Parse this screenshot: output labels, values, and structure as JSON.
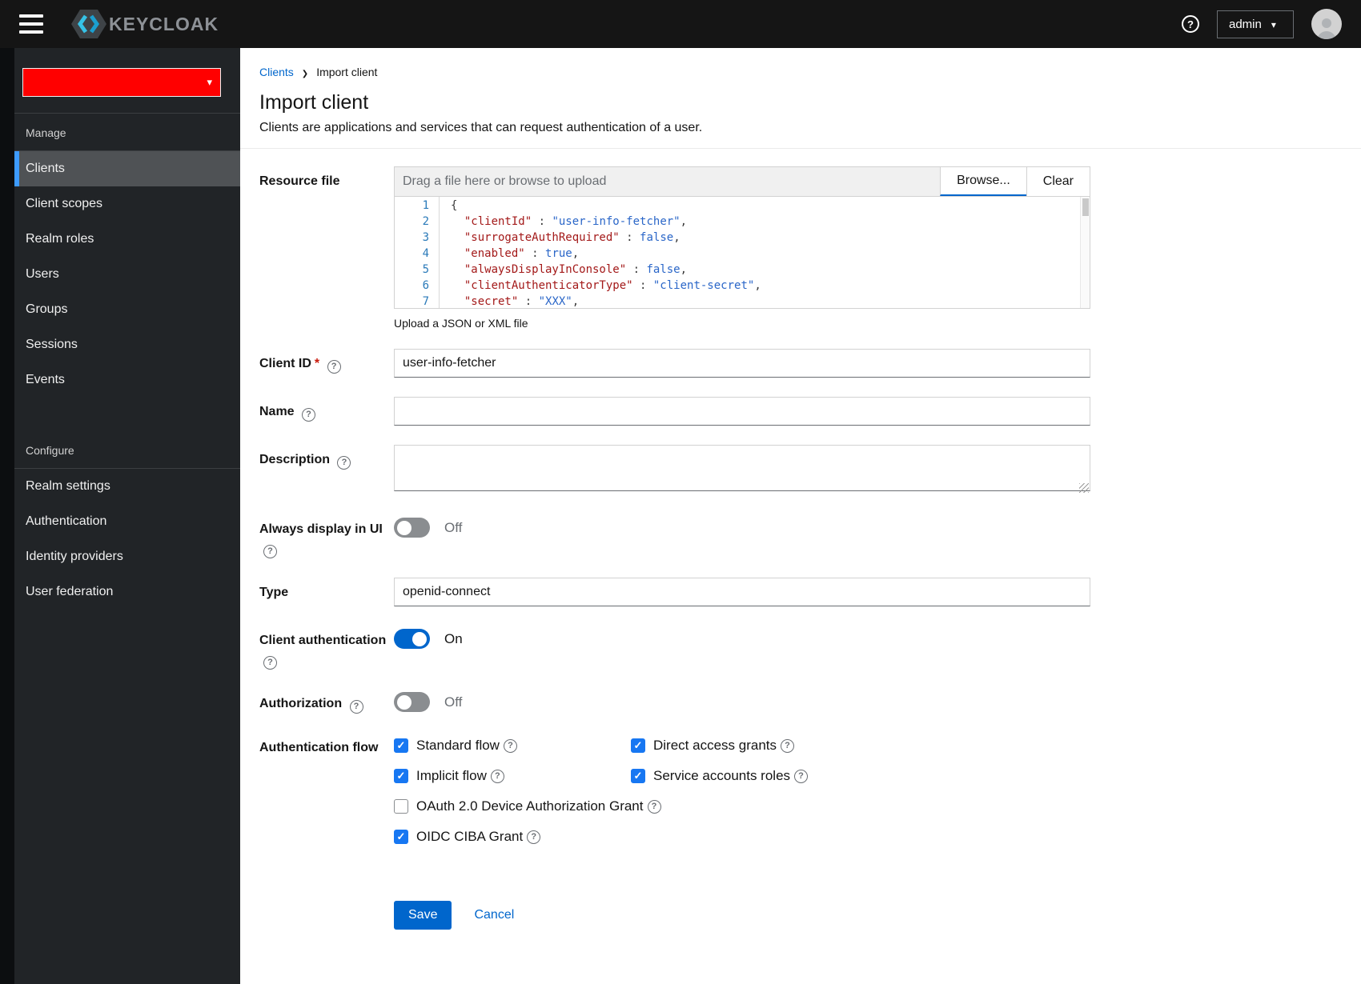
{
  "topbar": {
    "brand": "KEYCLOAK",
    "user": "admin"
  },
  "sidebar": {
    "sections": [
      {
        "label": "Manage",
        "items": [
          {
            "label": "Clients",
            "active": true
          },
          {
            "label": "Client scopes"
          },
          {
            "label": "Realm roles"
          },
          {
            "label": "Users"
          },
          {
            "label": "Groups"
          },
          {
            "label": "Sessions"
          },
          {
            "label": "Events"
          }
        ]
      },
      {
        "label": "Configure",
        "items": [
          {
            "label": "Realm settings"
          },
          {
            "label": "Authentication"
          },
          {
            "label": "Identity providers"
          },
          {
            "label": "User federation"
          }
        ]
      }
    ]
  },
  "breadcrumb": {
    "parent": "Clients",
    "current": "Import client"
  },
  "page": {
    "title": "Import client",
    "subtitle": "Clients are applications and services that can request authentication of a user."
  },
  "form": {
    "resource_file": {
      "label": "Resource file",
      "placeholder": "Drag a file here or browse to upload",
      "browse": "Browse...",
      "clear": "Clear",
      "helper": "Upload a JSON or XML file"
    },
    "code_editor": {
      "lines": [
        {
          "num": "1",
          "tokens": [
            {
              "t": "punc",
              "s": "{"
            }
          ]
        },
        {
          "num": "2",
          "tokens": [
            {
              "t": "ws",
              "s": "  "
            },
            {
              "t": "key",
              "s": "\"clientId\""
            },
            {
              "t": "punc",
              "s": " : "
            },
            {
              "t": "str",
              "s": "\"user-info-fetcher\""
            },
            {
              "t": "punc",
              "s": ","
            }
          ]
        },
        {
          "num": "3",
          "tokens": [
            {
              "t": "ws",
              "s": "  "
            },
            {
              "t": "key",
              "s": "\"surrogateAuthRequired\""
            },
            {
              "t": "punc",
              "s": " : "
            },
            {
              "t": "bool",
              "s": "false"
            },
            {
              "t": "punc",
              "s": ","
            }
          ]
        },
        {
          "num": "4",
          "tokens": [
            {
              "t": "ws",
              "s": "  "
            },
            {
              "t": "key",
              "s": "\"enabled\""
            },
            {
              "t": "punc",
              "s": " : "
            },
            {
              "t": "bool",
              "s": "true"
            },
            {
              "t": "punc",
              "s": ","
            }
          ]
        },
        {
          "num": "5",
          "tokens": [
            {
              "t": "ws",
              "s": "  "
            },
            {
              "t": "key",
              "s": "\"alwaysDisplayInConsole\""
            },
            {
              "t": "punc",
              "s": " : "
            },
            {
              "t": "bool",
              "s": "false"
            },
            {
              "t": "punc",
              "s": ","
            }
          ]
        },
        {
          "num": "6",
          "tokens": [
            {
              "t": "ws",
              "s": "  "
            },
            {
              "t": "key",
              "s": "\"clientAuthenticatorType\""
            },
            {
              "t": "punc",
              "s": " : "
            },
            {
              "t": "str",
              "s": "\"client-secret\""
            },
            {
              "t": "punc",
              "s": ","
            }
          ]
        },
        {
          "num": "7",
          "tokens": [
            {
              "t": "ws",
              "s": "  "
            },
            {
              "t": "key",
              "s": "\"secret\""
            },
            {
              "t": "punc",
              "s": " : "
            },
            {
              "t": "str",
              "s": "\"XXX\""
            },
            {
              "t": "punc",
              "s": ","
            }
          ]
        }
      ]
    },
    "client_id": {
      "label": "Client ID",
      "required": "*",
      "value": "user-info-fetcher"
    },
    "name": {
      "label": "Name",
      "value": ""
    },
    "description": {
      "label": "Description",
      "value": ""
    },
    "always_display": {
      "label": "Always display in UI",
      "state": "Off"
    },
    "type": {
      "label": "Type",
      "value": "openid-connect"
    },
    "client_auth": {
      "label": "Client authentication",
      "state": "On"
    },
    "authorization": {
      "label": "Authorization",
      "state": "Off"
    },
    "auth_flow": {
      "label": "Authentication flow",
      "options": [
        {
          "label": "Standard flow",
          "checked": true
        },
        {
          "label": "Direct access grants",
          "checked": true
        },
        {
          "label": "Implicit flow",
          "checked": true
        },
        {
          "label": "Service accounts roles",
          "checked": true
        },
        {
          "label": "OAuth 2.0 Device Authorization Grant",
          "checked": false,
          "wide": true
        },
        {
          "label": "OIDC CIBA Grant",
          "checked": true,
          "wide": true
        }
      ]
    },
    "actions": {
      "save": "Save",
      "cancel": "Cancel"
    }
  },
  "colors": {
    "accent": "#0066cc",
    "checkbox": "#1777f2",
    "nav_active_border": "#3d9bff",
    "realm_redaction": "#ff0000",
    "topbar_bg": "#151515",
    "sidebar_bg": "#212427"
  }
}
